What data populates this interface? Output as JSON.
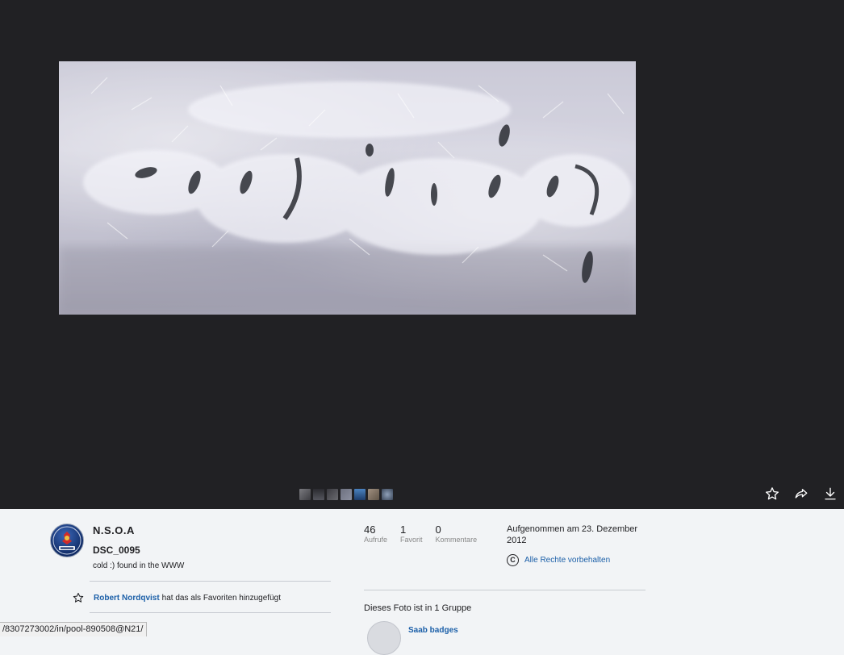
{
  "viewer": {
    "filmstrip_count": 7,
    "icons": [
      "star-icon",
      "share-icon",
      "download-icon"
    ]
  },
  "photo": {
    "author": "N.S.O.A",
    "title": "DSC_0095",
    "description": "cold :) found in the WWW"
  },
  "favorite_activity": {
    "user": "Robert Nordqvist",
    "text": "hat das als Favoriten hinzugefügt"
  },
  "stats": [
    {
      "value": "46",
      "label": "Aufrufe"
    },
    {
      "value": "1",
      "label": "Favorit"
    },
    {
      "value": "0",
      "label": "Kommentare"
    }
  ],
  "taken": "Aufgenommen am 23. Dezember 2012",
  "license": {
    "symbol": "C",
    "text": "Alle Rechte vorbehalten"
  },
  "groups": {
    "heading": "Dieses Foto ist in 1 Gruppe",
    "items": [
      {
        "name": "Saab badges"
      }
    ]
  },
  "status_url": "/8307273002/in/pool-890508@N21/",
  "colors": {
    "viewer_bg": "#212124",
    "details_bg": "#f2f4f6",
    "link": "#1b5fa8"
  }
}
